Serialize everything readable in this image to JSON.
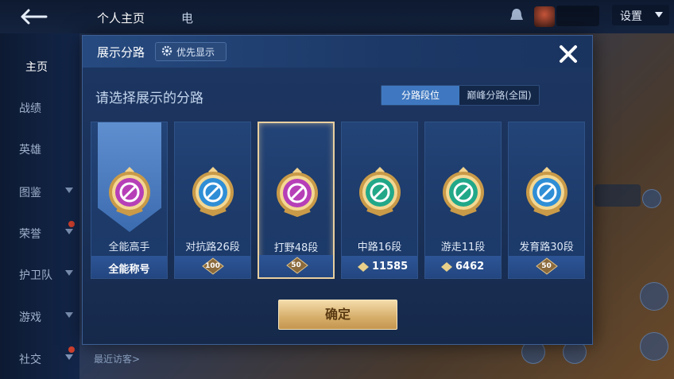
{
  "top_bar": {
    "tabs": [
      "个人主页",
      "电"
    ],
    "settings_label": "设置"
  },
  "side_nav": {
    "items": [
      {
        "label": "主页",
        "active": true,
        "arrow": false,
        "dot": false
      },
      {
        "label": "战绩",
        "active": false,
        "arrow": false,
        "dot": false
      },
      {
        "label": "英雄",
        "active": false,
        "arrow": false,
        "dot": false
      },
      {
        "label": "图鉴",
        "active": false,
        "arrow": true,
        "dot": false
      },
      {
        "label": "荣誉",
        "active": false,
        "arrow": true,
        "dot": true
      },
      {
        "label": "护卫队",
        "active": false,
        "arrow": true,
        "dot": false
      },
      {
        "label": "游戏",
        "active": false,
        "arrow": true,
        "dot": false
      },
      {
        "label": "社交",
        "active": false,
        "arrow": true,
        "dot": true
      }
    ]
  },
  "modal": {
    "title": "展示分路",
    "priority_label": "优先显示",
    "subtitle": "请选择展示的分路",
    "toggle": {
      "option_a": "分路段位",
      "option_b": "巅峰分路(全国)",
      "selected": "option_a"
    },
    "confirm_label": "确定",
    "cards": [
      {
        "rank": "全能高手",
        "footer_type": "text",
        "footer_text": "全能称号",
        "emblem_color": "#b63fb8",
        "selected": false,
        "ribbon": true
      },
      {
        "rank": "对抗路26段",
        "footer_type": "badge",
        "footer_text": "100",
        "emblem_color": "#2f8ed6",
        "selected": false,
        "ribbon": false
      },
      {
        "rank": "打野48段",
        "footer_type": "badge",
        "footer_text": "50",
        "emblem_color": "#b63fb8",
        "selected": true,
        "ribbon": false
      },
      {
        "rank": "中路16段",
        "footer_type": "points",
        "footer_text": "11585",
        "emblem_color": "#21a889",
        "selected": false,
        "ribbon": false
      },
      {
        "rank": "游走11段",
        "footer_type": "points",
        "footer_text": "6462",
        "emblem_color": "#21a889",
        "selected": false,
        "ribbon": false
      },
      {
        "rank": "发育路30段",
        "footer_type": "badge",
        "footer_text": "50",
        "emblem_color": "#2f8ed6",
        "selected": false,
        "ribbon": false
      }
    ]
  },
  "recent_visitors_label": "最近访客>",
  "colors": {
    "accent_blue": "#3f78c0",
    "gold": "#d6ae6a",
    "selected_border": "#e9cf9f"
  }
}
